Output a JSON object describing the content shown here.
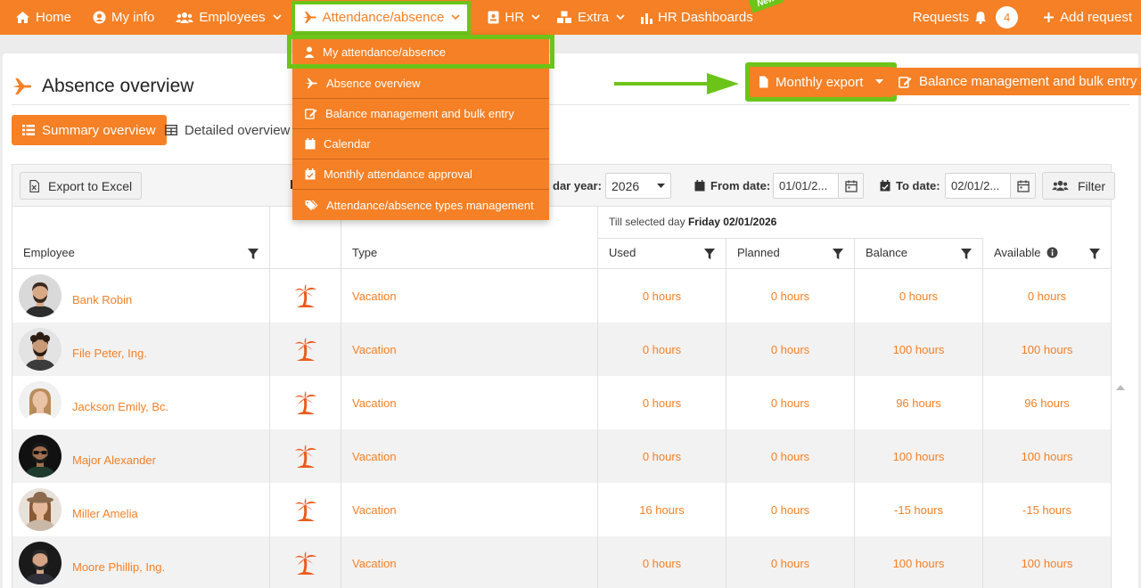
{
  "nav": {
    "home": "Home",
    "my_info": "My info",
    "employees": "Employees",
    "attendance": "Attendance/absence",
    "hr": "HR",
    "extra": "Extra",
    "hr_dashboards": "HR Dashboards",
    "new_badge": "New",
    "requests": "Requests",
    "requests_count": "4",
    "add_request": "Add request"
  },
  "dropdown": {
    "items": [
      {
        "label": "My attendance/absence",
        "icon": "person-icon"
      },
      {
        "label": "Absence overview",
        "icon": "airplane-icon"
      },
      {
        "label": "Balance management and bulk entry",
        "icon": "edit-icon"
      },
      {
        "label": "Calendar",
        "icon": "calendar-icon"
      },
      {
        "label": "Monthly attendance approval",
        "icon": "calendar-check-icon"
      },
      {
        "label": "Attendance/absence types management",
        "icon": "tags-icon"
      }
    ]
  },
  "page": {
    "title": "Absence overview",
    "monthly_export": "Monthly export",
    "balance_btn": "Balance management and bulk entry",
    "tab_summary": "Summary overview",
    "tab_detailed": "Detailed overview"
  },
  "toolbar": {
    "export_excel": "Export to Excel",
    "calendar_year_label": "dar year:",
    "calendar_year": "2026",
    "from_label": "From date:",
    "from_value": "01/01/2...",
    "to_label": "To date:",
    "to_value": "02/01/2...",
    "filter": "Filter"
  },
  "table": {
    "col_employee": "Employee",
    "col_type": "Type",
    "group_prefix": "Till selected day",
    "group_date": "Friday 02/01/2026",
    "col_used": "Used",
    "col_planned": "Planned",
    "col_balance": "Balance",
    "col_available": "Available",
    "rows": [
      {
        "name": "Bank Robin",
        "type": "Vacation",
        "used": "0 hours",
        "planned": "0 hours",
        "balance": "0 hours",
        "available": "0 hours"
      },
      {
        "name": "File Peter, Ing.",
        "type": "Vacation",
        "used": "0 hours",
        "planned": "0 hours",
        "balance": "100 hours",
        "available": "100 hours"
      },
      {
        "name": "Jackson Emily, Bc.",
        "type": "Vacation",
        "used": "0 hours",
        "planned": "0 hours",
        "balance": "96 hours",
        "available": "96 hours"
      },
      {
        "name": "Major Alexander",
        "type": "Vacation",
        "used": "0 hours",
        "planned": "0 hours",
        "balance": "100 hours",
        "available": "100 hours"
      },
      {
        "name": "Miller Amelia",
        "type": "Vacation",
        "used": "16 hours",
        "planned": "0 hours",
        "balance": "-15 hours",
        "available": "-15 hours"
      },
      {
        "name": "Moore Phillip, Ing.",
        "type": "Vacation",
        "used": "0 hours",
        "planned": "0 hours",
        "balance": "100 hours",
        "available": "100 hours"
      }
    ]
  },
  "colors": {
    "brand": "#f58025",
    "highlight": "#6cc419"
  }
}
